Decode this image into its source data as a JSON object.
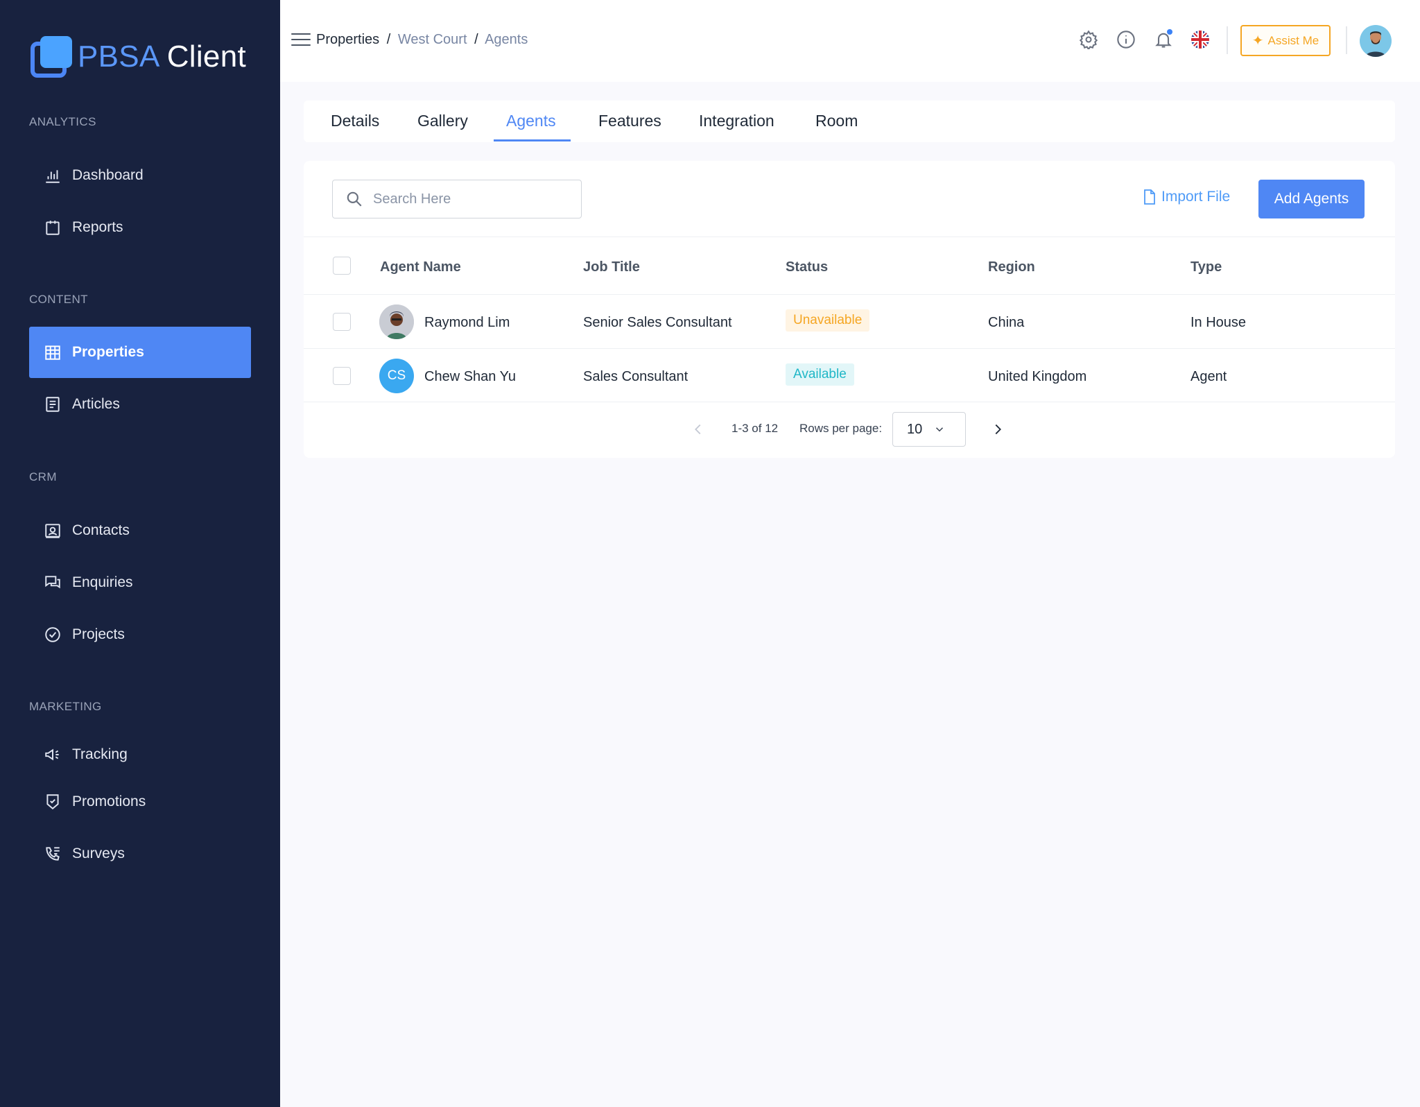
{
  "app": {
    "logo_primary": "PBSA",
    "logo_secondary": "Client"
  },
  "sidebar": {
    "sections": {
      "analytics": "ANALYTICS",
      "content": "CONTENT",
      "crm": "CRM",
      "marketing": "MARKETING"
    },
    "items": {
      "dashboard": "Dashboard",
      "reports": "Reports",
      "properties": "Properties",
      "articles": "Articles",
      "contacts": "Contacts",
      "enquiries": "Enquiries",
      "projects": "Projects",
      "tracking": "Tracking",
      "promotions": "Promotions",
      "surveys": "Surveys"
    },
    "active_item": "properties"
  },
  "header": {
    "breadcrumb": [
      "Properties",
      "West Court",
      "Agents"
    ],
    "separator": "/",
    "assist_label": "Assist Me",
    "notification_dot": true
  },
  "tabs": [
    "Details",
    "Gallery",
    "Agents",
    "Features",
    "Integration",
    "Room"
  ],
  "active_tab": "Agents",
  "toolbar": {
    "search_placeholder": "Search Here",
    "import_label": "Import File",
    "add_label": "Add Agents"
  },
  "table": {
    "columns": [
      "Agent Name",
      "Job Title",
      "Status",
      "Region",
      "Type"
    ],
    "rows": [
      {
        "name": "Raymond Lim",
        "avatar": "photo",
        "job_title": "Senior Sales Consultant",
        "status": "Unavailable",
        "region": "China",
        "type": "In House"
      },
      {
        "name": "Chew Shan Yu",
        "avatar_initials": "CS",
        "job_title": "Sales Consultant",
        "status": "Available",
        "region": "United Kingdom",
        "type": "Agent"
      }
    ]
  },
  "pagination": {
    "range": "1-3 of 12",
    "rows_label": "Rows per page:",
    "rows_value": "10"
  },
  "colors": {
    "sidebar_bg": "#18223f",
    "accent": "#4f87f4",
    "assist": "#f5a623",
    "available": "#1fb7c7",
    "unavailable": "#f5a623"
  }
}
